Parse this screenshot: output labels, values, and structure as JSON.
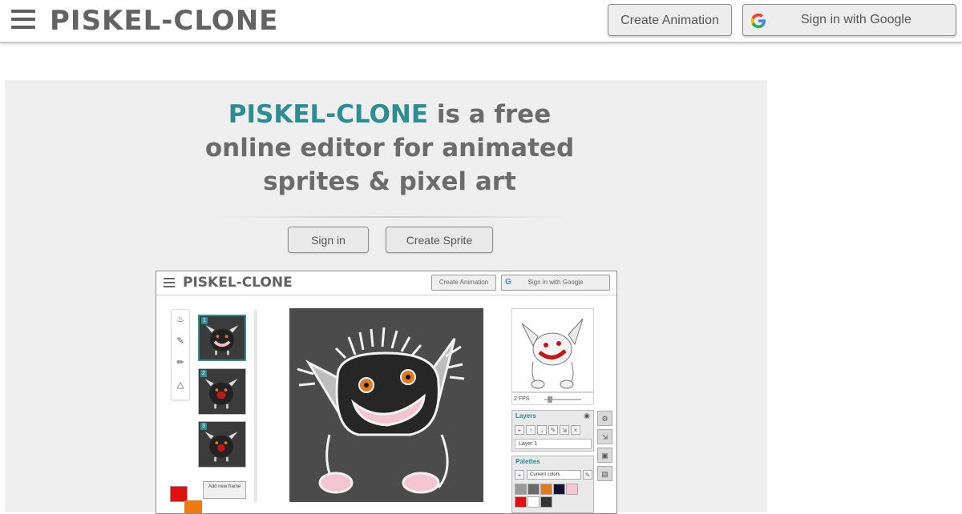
{
  "header": {
    "logo": "PISKEL-CLONE",
    "create_animation": "Create Animation",
    "sign_in_google": "Sign in with Google"
  },
  "hero": {
    "headline_brand": "PISKEL-CLONE",
    "headline_line1_rest": " is a free",
    "headline_line2": "online editor for animated",
    "headline_line3": "sprites & pixel art",
    "sign_in": "Sign in",
    "create_sprite": "Create Sprite"
  },
  "preview": {
    "logo": "PISKEL-CLONE",
    "create_animation": "Create Animation",
    "sign_in_google": "Sign in with Google",
    "google_g": "G",
    "frame_numbers": [
      "1",
      "2",
      "3"
    ],
    "fps": "2 FPS",
    "layers_title": "Layers",
    "layer_name": "Layer 1",
    "palettes_title": "Palettes",
    "palette_select": "Current colors",
    "add_new_frame": "Add new frame"
  },
  "colors": {
    "brand_teal": "#2c8d93",
    "text_gray": "#6b6b6b",
    "primary_color": "#e01010",
    "secondary_color": "#f07a10"
  }
}
